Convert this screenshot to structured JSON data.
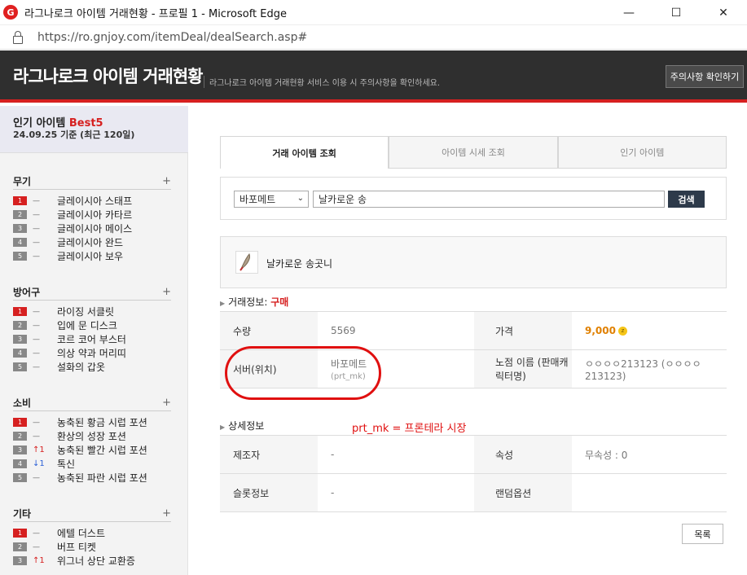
{
  "window": {
    "title": "라그나로크 아이템 거래현황 - 프로필 1 - Microsoft Edge",
    "controls": [
      "—",
      "☐",
      "✕"
    ]
  },
  "address": {
    "url": "https://ro.gnjoy.com/itemDeal/dealSearch.asp#"
  },
  "header": {
    "title": "라그나로크 아이템 거래현황",
    "subtitle": "라그나로크 아이템 거래현황 서비스 이용 시 주의사항을 확인하세요.",
    "notice_button": "주의사항 확인하기"
  },
  "sidebar": {
    "best_title": "인기 아이템",
    "best_highlight": "Best5",
    "best_date": "24.09.25 기준 (최근 120일)",
    "categories": [
      {
        "name": "무기",
        "plus": "+",
        "items": [
          {
            "rank": "1",
            "trend": "—",
            "name": "글레이시아 스태프"
          },
          {
            "rank": "2",
            "trend": "—",
            "name": "글레이시아 카타르"
          },
          {
            "rank": "3",
            "trend": "—",
            "name": "글레이시아 메이스"
          },
          {
            "rank": "4",
            "trend": "—",
            "name": "글레이시아 완드"
          },
          {
            "rank": "5",
            "trend": "—",
            "name": "글레이시아 보우"
          }
        ]
      },
      {
        "name": "방어구",
        "plus": "+",
        "items": [
          {
            "rank": "1",
            "trend": "—",
            "name": "라이징 서클릿"
          },
          {
            "rank": "2",
            "trend": "—",
            "name": "입에 문 디스크"
          },
          {
            "rank": "3",
            "trend": "—",
            "name": "코르 코어 부스터"
          },
          {
            "rank": "4",
            "trend": "—",
            "name": "의상 약과 머리띠"
          },
          {
            "rank": "5",
            "trend": "—",
            "name": "설화의 갑옷"
          }
        ]
      },
      {
        "name": "소비",
        "plus": "+",
        "items": [
          {
            "rank": "1",
            "trend": "—",
            "name": "농축된 황금 시럽 포션"
          },
          {
            "rank": "2",
            "trend": "—",
            "name": "환상의 성장 포션"
          },
          {
            "rank": "3",
            "trend": "↑1",
            "dir": "up",
            "name": "농축된 빨간 시럽 포션"
          },
          {
            "rank": "4",
            "trend": "↓1",
            "dir": "down",
            "name": "톡신"
          },
          {
            "rank": "5",
            "trend": "—",
            "name": "농축된 파란 시럽 포션"
          }
        ]
      },
      {
        "name": "기타",
        "plus": "+",
        "items": [
          {
            "rank": "1",
            "trend": "—",
            "name": "에텔 더스트"
          },
          {
            "rank": "2",
            "trend": "—",
            "name": "버프 티켓"
          },
          {
            "rank": "3",
            "trend": "↑1",
            "dir": "up",
            "name": "위그너 상단 교환증"
          }
        ]
      }
    ]
  },
  "tabs": [
    "거래 아이템 조회",
    "아이템 시세 조회",
    "인기 아이템"
  ],
  "search": {
    "server": "바포메트",
    "query": "날카로운 송",
    "button": "검색"
  },
  "item": {
    "name": "날카로운 송곳니"
  },
  "trade_info": {
    "label": "거래정보:",
    "type": "구매",
    "quantity_label": "수량",
    "quantity": "5569",
    "price_label": "가격",
    "price": "9,000",
    "server_label": "서버(위치)",
    "server": "바포메트",
    "server_code": "(prt_mk)",
    "shop_label": "노점 이름 (판매캐릭터명)",
    "shop": "ㅇㅇㅇㅇ213123 (ㅇㅇㅇㅇ213123)"
  },
  "detail_info": {
    "label": "상세정보",
    "maker_label": "제조자",
    "maker": "-",
    "attr_label": "속성",
    "attr": "무속성 : 0",
    "slot_label": "슬롯정보",
    "slot": "-",
    "random_label": "랜덤옵션",
    "random": ""
  },
  "annotation": {
    "text": "prt_mk = 프론테라 시장",
    "color": "#e01010"
  },
  "list_button": "목록"
}
